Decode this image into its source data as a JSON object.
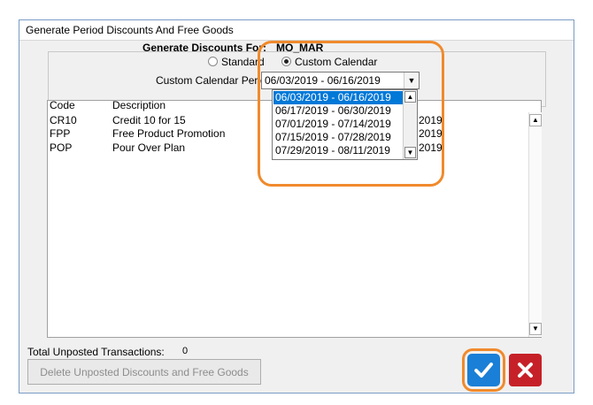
{
  "window": {
    "title": "Generate Period Discounts And Free Goods"
  },
  "generate": {
    "label": "Generate Discounts For:",
    "value": "MO_MAR"
  },
  "options": {
    "standard_label": "Standard",
    "custom_label": "Custom Calendar",
    "selected": "custom"
  },
  "period": {
    "label": "Custom Calendar Period",
    "value": "06/03/2019 - 06/16/2019",
    "options": [
      "06/03/2019 - 06/16/2019",
      "06/17/2019 - 06/30/2019",
      "07/01/2019 - 07/14/2019",
      "07/15/2019 - 07/28/2019",
      "07/29/2019 - 08/11/2019"
    ]
  },
  "table": {
    "headers": {
      "code": "Code",
      "description": "Description"
    },
    "rows": [
      {
        "code": "CR10",
        "description": "Credit 10 for 15",
        "date_tail": "2019"
      },
      {
        "code": "FPP",
        "description": "Free Product Promotion",
        "date_tail": "2019"
      },
      {
        "code": "POP",
        "description": "Pour Over Plan",
        "date_tail": "2019"
      }
    ]
  },
  "footer": {
    "total_label": "Total Unposted Transactions:",
    "total_value": "0",
    "delete_label": "Delete Unposted Discounts and Free Goods"
  },
  "colors": {
    "accent": "#f08a2c",
    "ok": "#1a7fd6",
    "cancel": "#c62128",
    "selection": "#0078d7"
  }
}
